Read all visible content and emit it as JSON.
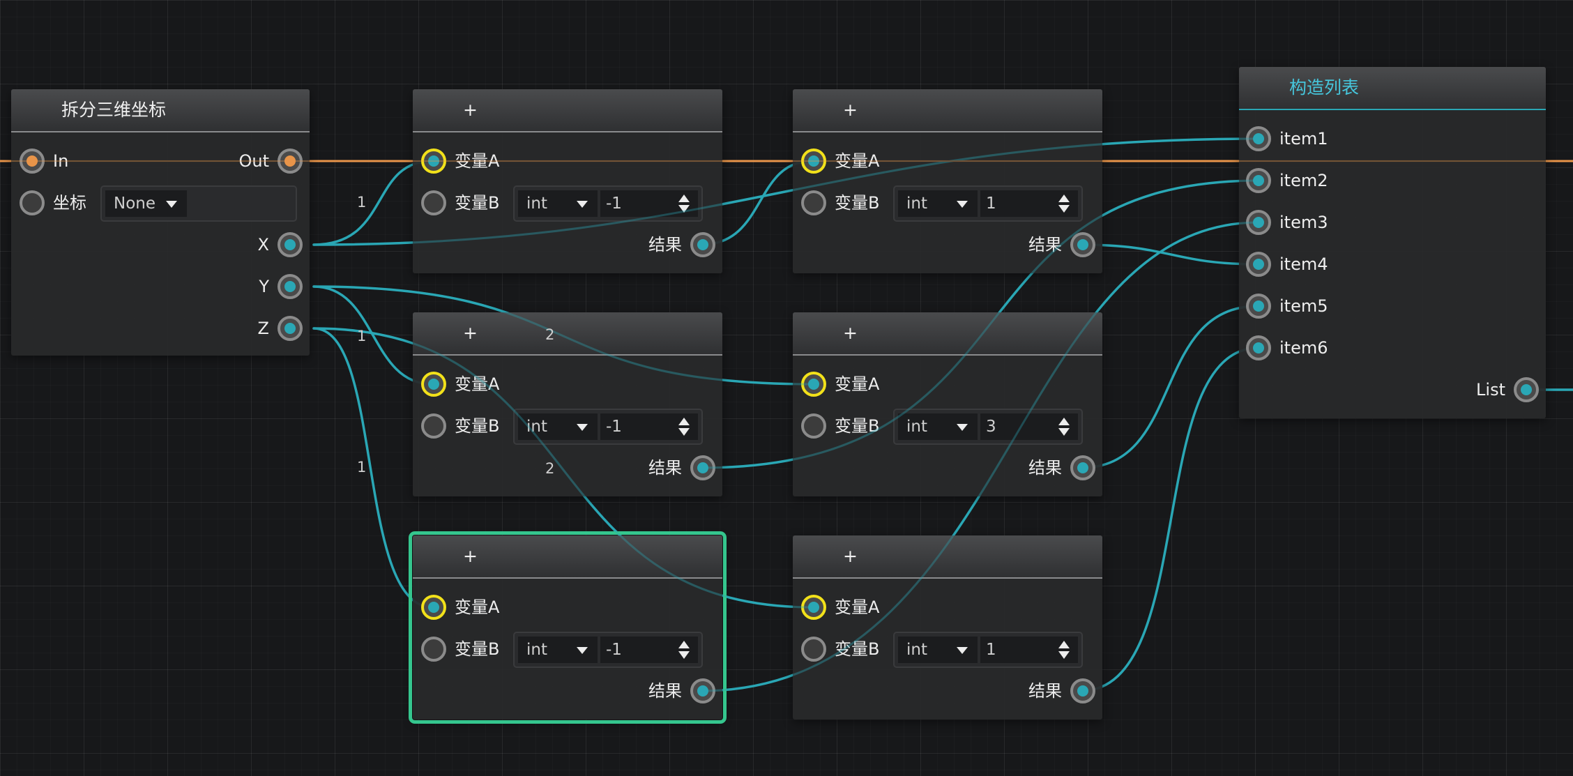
{
  "canvas": {
    "colors": {
      "background": "#17181a",
      "wire_data": "#2aa7b5",
      "wire_exec": "#e89449",
      "selection": "#35c68e",
      "port_input_highlight": "#f2e11a"
    }
  },
  "split_node": {
    "title": "拆分三维坐标",
    "in_label": "In",
    "out_label": "Out",
    "coord_label": "坐标",
    "coord_select_value": "None",
    "x_label": "X",
    "y_label": "Y",
    "z_label": "Z"
  },
  "add_nodes": [
    {
      "title": "+",
      "input_a": "变量A",
      "input_b": "变量B",
      "type_value": "int",
      "number_value": "-1",
      "output": "结果",
      "selected": false
    },
    {
      "title": "+",
      "input_a": "变量A",
      "input_b": "变量B",
      "type_value": "int",
      "number_value": "1",
      "output": "结果",
      "selected": false
    },
    {
      "title": "+",
      "input_a": "变量A",
      "input_b": "变量B",
      "type_value": "int",
      "number_value": "-1",
      "output": "结果",
      "selected": false
    },
    {
      "title": "+",
      "input_a": "变量A",
      "input_b": "变量B",
      "type_value": "int",
      "number_value": "3",
      "output": "结果",
      "selected": false
    },
    {
      "title": "+",
      "input_a": "变量A",
      "input_b": "变量B",
      "type_value": "int",
      "number_value": "-1",
      "output": "结果",
      "selected": true
    },
    {
      "title": "+",
      "input_a": "变量A",
      "input_b": "变量B",
      "type_value": "int",
      "number_value": "1",
      "output": "结果",
      "selected": false
    }
  ],
  "list_node": {
    "title": "构造列表",
    "items": [
      "item1",
      "item2",
      "item3",
      "item4",
      "item5",
      "item6"
    ],
    "output": "List"
  },
  "wire_labels": [
    "1",
    "1",
    "1",
    "2",
    "2"
  ]
}
